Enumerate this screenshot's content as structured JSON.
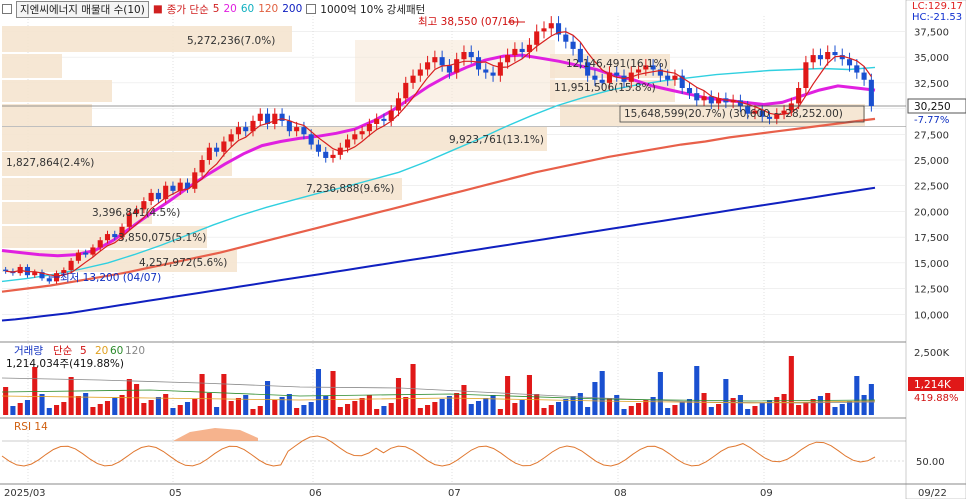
{
  "stock": {
    "name": "지엔씨에너지 매물대 수(10)",
    "ma_label": "종가 단순",
    "ma_periods": [
      "5",
      "20",
      "60",
      "120",
      "200"
    ],
    "ma_colors": [
      "#e03020",
      "#e020e0",
      "#20c0d0",
      "#e06040",
      "#1020c0"
    ],
    "pattern_label": "1000억 10% 강세패턴"
  },
  "right_info": {
    "lc": "LC:129.17",
    "hc": "HC:-21.53"
  },
  "price_axis": [
    "37,500",
    "35,000",
    "32,500",
    "30,000",
    "27,500",
    "25,000",
    "22,500",
    "20,000",
    "17,500",
    "15,000",
    "12,500",
    "10,000"
  ],
  "current_price": {
    "value": "30,250",
    "change": "-7.77%"
  },
  "annotations": {
    "high": "최고 38,550 (07/16)",
    "low": "최저 13,200 (04/07)"
  },
  "volume_profile": [
    "5,272,236(7.0%)",
    "12,146,491(16.1%)",
    "11,951,506(15.8%)",
    "15,648,599(20.7%)",
    "9,923,761(13.1%)",
    "1,827,864(2.4%)",
    "7,236,888(9.6%)",
    "3,396,841(4.5%)",
    "3,850,075(5.1%)",
    "4,257,972(5.6%)"
  ],
  "price_label_mid": "(30,600 ~ 28,252.00)",
  "volume_panel": {
    "title": "거래량",
    "ma_label": "단순",
    "ma_periods": [
      "5",
      "20",
      "60",
      "120"
    ],
    "value_text": "1,214,034주(419.88%)",
    "axis_top": "2,500K",
    "current": "1,214K",
    "current_pct": "419.88%"
  },
  "rsi_panel": {
    "title": "RSI 14",
    "axis": "50.00"
  },
  "time_axis": [
    "2025/03",
    "05",
    "06",
    "07",
    "08",
    "09",
    "09/22"
  ],
  "chart_data": {
    "type": "candlestick",
    "x_labels": [
      "2025/03",
      "05",
      "06",
      "07",
      "08",
      "09"
    ],
    "y_range": [
      7500,
      39000
    ],
    "high": 38550,
    "low": 13200,
    "last_close": 30250,
    "volume_last": 1214034,
    "volume_last_pct": 419.88,
    "closes": [
      14200,
      14000,
      14600,
      13800,
      14100,
      13500,
      13200,
      14000,
      14300,
      15200,
      16000,
      15800,
      16500,
      17200,
      17800,
      17500,
      18500,
      19800,
      20200,
      21000,
      21800,
      21200,
      22500,
      22000,
      22800,
      22200,
      23800,
      25000,
      26200,
      25800,
      26800,
      27500,
      28200,
      27800,
      28800,
      29500,
      28500,
      29500,
      28800,
      27800,
      28200,
      27500,
      26500,
      25800,
      25200,
      25500,
      26200,
      27000,
      27500,
      27800,
      28500,
      29000,
      28800,
      29800,
      31000,
      32500,
      33200,
      33800,
      34500,
      35000,
      34200,
      33500,
      34800,
      35500,
      35000,
      33800,
      33500,
      33200,
      34500,
      35200,
      35800,
      35500,
      36200,
      37500,
      37800,
      38300,
      37200,
      36500,
      35800,
      34500,
      33200,
      32800,
      32500,
      33500,
      33200,
      32600,
      33500,
      33800,
      34200,
      33800,
      33200,
      32800,
      33200,
      32000,
      31500,
      30800,
      31200,
      30500,
      31000,
      30600,
      30800,
      30200,
      29500,
      29800,
      29200,
      29000,
      29500,
      29800,
      30500,
      32000,
      34500,
      35200,
      34800,
      35500,
      35200,
      34800,
      34200,
      33500,
      32800,
      30250
    ],
    "ma200": [
      9400,
      9500,
      9650,
      9800,
      9950,
      10100,
      10300,
      10500,
      10700,
      10900,
      11100,
      11300,
      11500,
      11700,
      11900,
      12100,
      12300,
      12500,
      12700,
      12900,
      13100,
      13300,
      13500,
      13700,
      13900,
      14100,
      14300,
      14500,
      14700,
      14900,
      15100,
      15300,
      15500,
      15700,
      15900,
      16100,
      16300,
      16500,
      16700,
      16900,
      17100,
      17300,
      17500,
      17700,
      17900,
      18100,
      18300,
      18500,
      18700,
      18900,
      19100,
      19300,
      19500,
      19700,
      19900,
      20100,
      20300,
      20500,
      20700,
      20900,
      21100,
      21300,
      21500,
      21700,
      21900,
      22100,
      22300
    ],
    "ma120": [
      12200,
      12500,
      12800,
      13200,
      13600,
      14000,
      14500,
      15000,
      15500,
      16000,
      16600,
      17200,
      17800,
      18400,
      19000,
      19600,
      20200,
      20800,
      21400,
      22000,
      22600,
      23200,
      23800,
      24300,
      24800,
      25300,
      25700,
      26100,
      26500,
      26800,
      27200,
      27500,
      27800,
      28100,
      28400,
      28700,
      29000
    ],
    "ma60": [
      13200,
      13500,
      13900,
      14400,
      15000,
      15800,
      16700,
      17700,
      18700,
      19600,
      20400,
      21100,
      21800,
      22400,
      23100,
      23800,
      24800,
      25900,
      27000,
      28200,
      29300,
      30300,
      31100,
      31800,
      32300,
      32700,
      33000,
      33300,
      33500,
      33700,
      33800,
      33900,
      33800,
      34000
    ],
    "ma20": [
      16200,
      16000,
      15800,
      15700,
      15800,
      16200,
      17200,
      18500,
      19800,
      21000,
      22300,
      23500,
      24600,
      25600,
      26400,
      26800,
      27100,
      27300,
      27600,
      28000,
      28800,
      29800,
      31000,
      32200,
      33200,
      34000,
      34700,
      35100,
      35200,
      34900,
      34600,
      34200,
      33800,
      33200,
      32800,
      32200,
      31800,
      31400,
      31000,
      30800,
      30600,
      30400,
      30600,
      31200,
      31800,
      32200,
      32000,
      31800
    ]
  }
}
